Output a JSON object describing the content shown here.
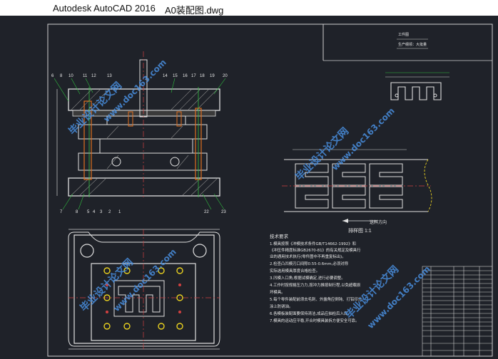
{
  "window": {
    "app_title": "Autodesk AutoCAD 2016",
    "file_name": "A0装配图.dwg"
  },
  "drawing": {
    "strip_caption": "排样图 1:1",
    "feed_direction": "送料方向",
    "header_labels": [
      "工件图",
      "生产纲领：大批量"
    ],
    "section_callouts_top": [
      "6",
      "8",
      "10",
      "11",
      "12",
      "13",
      "14",
      "15",
      "16",
      "17",
      "18",
      "19",
      "20"
    ],
    "section_callouts_bottom": [
      "7",
      "8",
      "5",
      "4",
      "3",
      "2",
      "1",
      "22",
      "23"
    ],
    "tech_title": "技术要求",
    "tech_lines": [
      "1.模具按照《冲模技术条件GB/T14662-1992》和",
      "《冲压件精度标准GB2670-81》的有关规定及模具行",
      "业的通用技术执行(零件图中不再重复标出)。",
      "2.检查凸凹模刃口间隙0.55-0.6mm,必须对称",
      "实际选用模具厚度合格检查。",
      "3.凹模入口角,根据试模确定,进行必要调整。",
      "4.工作时按规格压力力,按冲力推按制行程,以免超载损",
      "坏模具。",
      "5.每个零件装配前须去毛刺、外露角应倒钝、打铅印分",
      "涂上防锈油。",
      "6.各模板装配面要保持清洁,成品应抽检后入库。",
      "7.模具的运动应平稳,开合时模具装拆方便安全可靠。"
    ],
    "watermarks": [
      "毕业设计论文网",
      "www.doc163.com"
    ]
  }
}
